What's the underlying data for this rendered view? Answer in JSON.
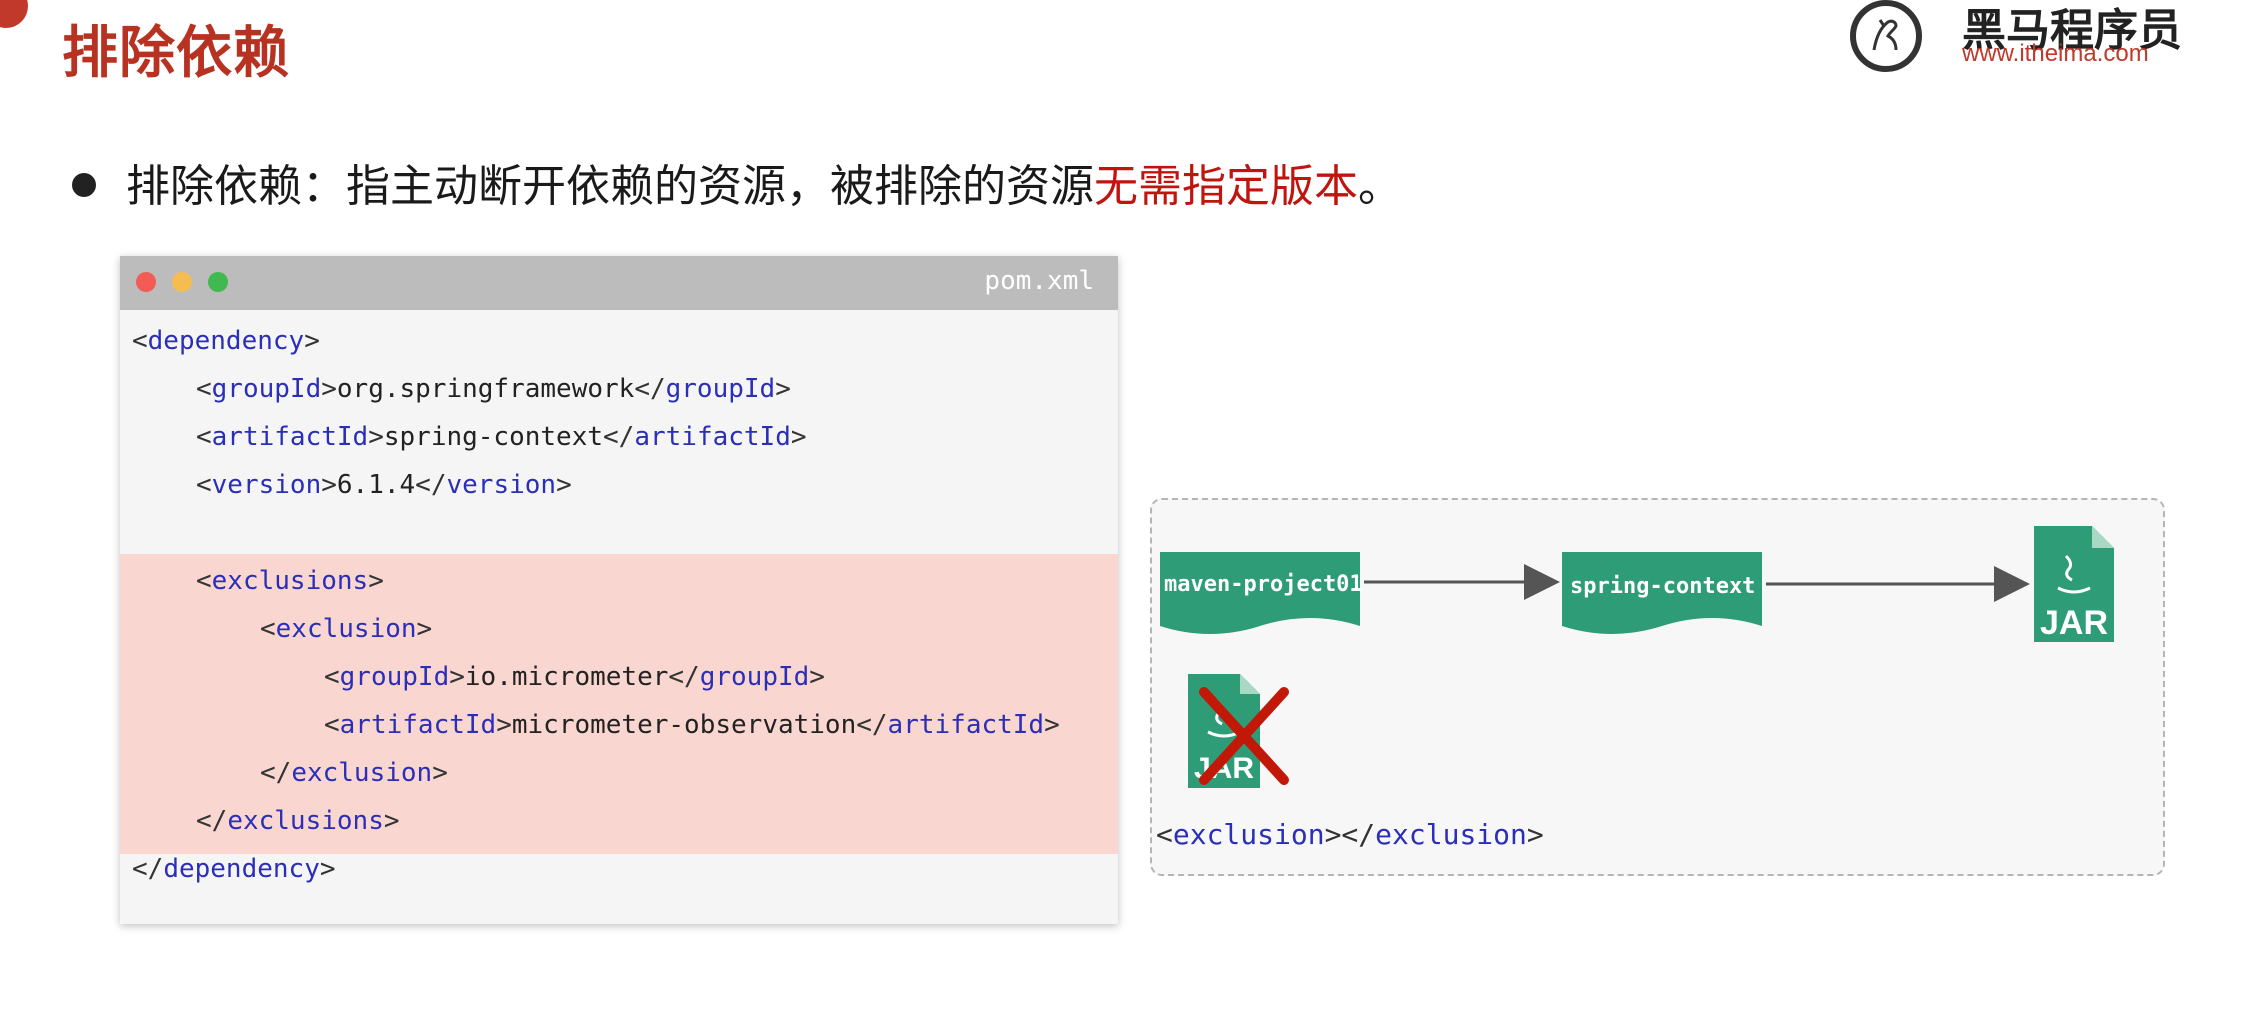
{
  "header": {
    "title": "排除依赖",
    "logo_cn": "黑马程序员",
    "logo_url": "www.itheima.com"
  },
  "bullet": {
    "text": "排除依赖：指主动断开依赖的资源，被排除的资源",
    "highlight": "无需指定版本",
    "end": "。"
  },
  "code": {
    "file_name": "pom.xml",
    "lines": [
      {
        "indent": 0,
        "open": "dependency",
        "text": "",
        "close": ""
      },
      {
        "indent": 1,
        "open": "groupId",
        "text": "org.springframework",
        "close": "groupId"
      },
      {
        "indent": 1,
        "open": "artifactId",
        "text": "spring-context",
        "close": "artifactId"
      },
      {
        "indent": 1,
        "open": "version",
        "text": "6.1.4",
        "close": "version"
      },
      {
        "indent": 1,
        "open": "exclusions",
        "text": "",
        "close": ""
      },
      {
        "indent": 2,
        "open": "exclusion",
        "text": "",
        "close": ""
      },
      {
        "indent": 3,
        "open": "groupId",
        "text": "io.micrometer",
        "close": "groupId"
      },
      {
        "indent": 3,
        "open": "artifactId",
        "text": "micrometer-observation",
        "close": "artifactId"
      },
      {
        "indent": 2,
        "open": "",
        "text": "",
        "close": "exclusion"
      },
      {
        "indent": 1,
        "open": "",
        "text": "",
        "close": "exclusions"
      },
      {
        "indent": 0,
        "open": "",
        "text": "",
        "close": "dependency"
      }
    ]
  },
  "diagram": {
    "node1": "maven-project01",
    "node2": "spring-context",
    "jar_label": "JAR",
    "excl_open": "exclusion",
    "excl_close": "exclusion"
  },
  "colors": {
    "accent_red": "#c0150f",
    "tag_blue": "#2b2fb8",
    "node_green": "#2e9c76",
    "exclusion_highlight": "#fad6d1"
  }
}
